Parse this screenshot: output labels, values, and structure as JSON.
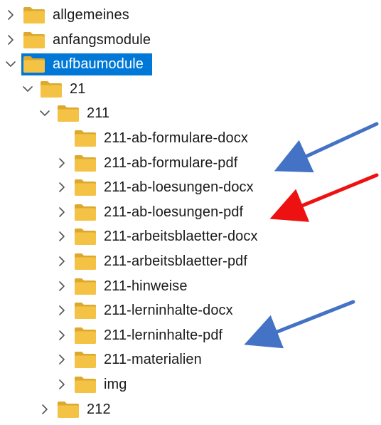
{
  "tree": {
    "items": [
      {
        "label": "allgemeines",
        "level": 0,
        "chevron": "right",
        "selected": false
      },
      {
        "label": "anfangsmodule",
        "level": 0,
        "chevron": "right",
        "selected": false
      },
      {
        "label": "aufbaumodule",
        "level": 0,
        "chevron": "down",
        "selected": true
      },
      {
        "label": "21",
        "level": 1,
        "chevron": "down",
        "selected": false
      },
      {
        "label": "211",
        "level": 2,
        "chevron": "down",
        "selected": false
      },
      {
        "label": "211-ab-formulare-docx",
        "level": 3,
        "chevron": "none",
        "selected": false
      },
      {
        "label": "211-ab-formulare-pdf",
        "level": 3,
        "chevron": "right",
        "selected": false
      },
      {
        "label": "211-ab-loesungen-docx",
        "level": 3,
        "chevron": "right",
        "selected": false
      },
      {
        "label": "211-ab-loesungen-pdf",
        "level": 3,
        "chevron": "right",
        "selected": false
      },
      {
        "label": "211-arbeitsblaetter-docx",
        "level": 3,
        "chevron": "right",
        "selected": false
      },
      {
        "label": "211-arbeitsblaetter-pdf",
        "level": 3,
        "chevron": "right",
        "selected": false
      },
      {
        "label": "211-hinweise",
        "level": 3,
        "chevron": "right",
        "selected": false
      },
      {
        "label": "211-lerninhalte-docx",
        "level": 3,
        "chevron": "right",
        "selected": false
      },
      {
        "label": "211-lerninhalte-pdf",
        "level": 3,
        "chevron": "right",
        "selected": false
      },
      {
        "label": "211-materialien",
        "level": 3,
        "chevron": "right",
        "selected": false
      },
      {
        "label": "img",
        "level": 3,
        "chevron": "right",
        "selected": false
      },
      {
        "label": "212",
        "level": 2,
        "chevron": "right",
        "selected": false
      }
    ]
  },
  "colors": {
    "selection": "#0078d7",
    "folder_body": "#f4c245",
    "folder_back": "#dca92c",
    "chevron": "#555555",
    "arrow_blue": "#4472c4",
    "arrow_red": "#ee1111"
  }
}
